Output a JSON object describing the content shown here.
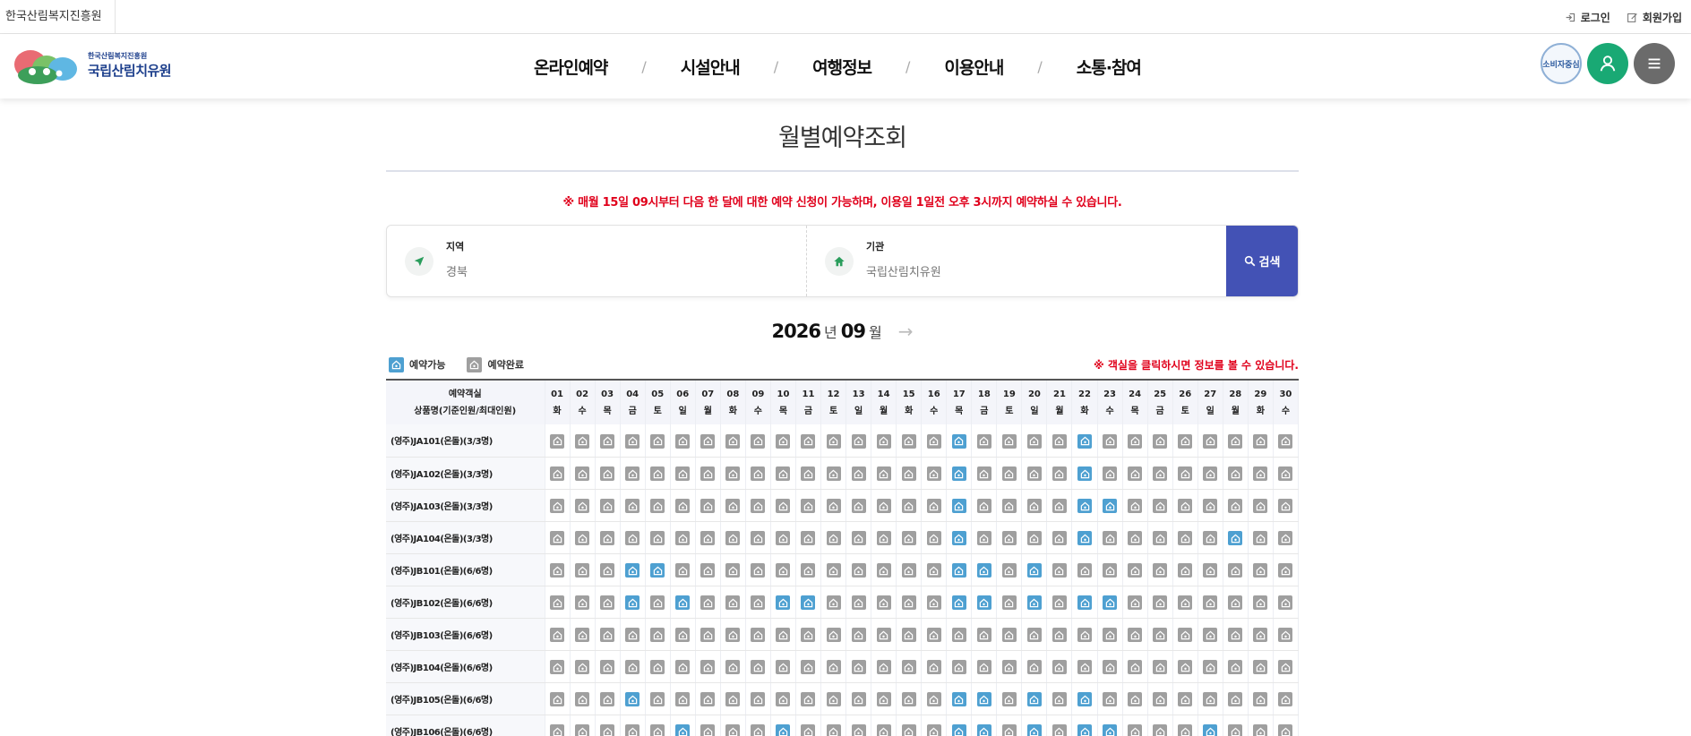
{
  "util": {
    "org_name": "한국산림복지진흥원",
    "login_label": "로그인",
    "join_label": "회원가입"
  },
  "header": {
    "logo_small": "한국산림복지진흥원",
    "logo_big": "국립산림치유원",
    "badge_text": "소비자중심",
    "nav": [
      "온라인예약",
      "시설안내",
      "여행정보",
      "이용안내",
      "소통·참여"
    ]
  },
  "page": {
    "title": "월별예약조회",
    "notice": "※ 매월 15일 09시부터 다음 한 달에 대한 예약 신청이 가능하며, 이용일 1일전 오후 3시까지 예약하실 수 있습니다."
  },
  "search": {
    "region_label": "지역",
    "region_value": "경북",
    "agency_label": "기관",
    "agency_value": "국립산림치유원",
    "button_label": "검색"
  },
  "month": {
    "year": "2026",
    "year_unit": "년",
    "month": "09",
    "month_unit": "월"
  },
  "legend": {
    "available": "예약가능",
    "completed": "예약완료",
    "note": "※ 객실을 클릭하시면 정보를 볼 수 있습니다."
  },
  "table": {
    "header_line1": "예약객실",
    "header_line2": "상품명(기준인원/최대인원)",
    "days": [
      {
        "num": "01",
        "dow": "화"
      },
      {
        "num": "02",
        "dow": "수"
      },
      {
        "num": "03",
        "dow": "목"
      },
      {
        "num": "04",
        "dow": "금"
      },
      {
        "num": "05",
        "dow": "토"
      },
      {
        "num": "06",
        "dow": "일"
      },
      {
        "num": "07",
        "dow": "월"
      },
      {
        "num": "08",
        "dow": "화"
      },
      {
        "num": "09",
        "dow": "수"
      },
      {
        "num": "10",
        "dow": "목"
      },
      {
        "num": "11",
        "dow": "금"
      },
      {
        "num": "12",
        "dow": "토"
      },
      {
        "num": "13",
        "dow": "일"
      },
      {
        "num": "14",
        "dow": "월"
      },
      {
        "num": "15",
        "dow": "화"
      },
      {
        "num": "16",
        "dow": "수"
      },
      {
        "num": "17",
        "dow": "목"
      },
      {
        "num": "18",
        "dow": "금"
      },
      {
        "num": "19",
        "dow": "토"
      },
      {
        "num": "20",
        "dow": "일"
      },
      {
        "num": "21",
        "dow": "월"
      },
      {
        "num": "22",
        "dow": "화"
      },
      {
        "num": "23",
        "dow": "수"
      },
      {
        "num": "24",
        "dow": "목"
      },
      {
        "num": "25",
        "dow": "금"
      },
      {
        "num": "26",
        "dow": "토"
      },
      {
        "num": "27",
        "dow": "일"
      },
      {
        "num": "28",
        "dow": "월"
      },
      {
        "num": "29",
        "dow": "화"
      },
      {
        "num": "30",
        "dow": "수"
      }
    ],
    "rows": [
      {
        "name": "(영주)JA101(온돌)(3/3명)",
        "available": [
          17,
          22
        ]
      },
      {
        "name": "(영주)JA102(온돌)(3/3명)",
        "available": [
          17,
          22
        ]
      },
      {
        "name": "(영주)JA103(온돌)(3/3명)",
        "available": [
          17,
          22,
          23
        ]
      },
      {
        "name": "(영주)JA104(온돌)(3/3명)",
        "available": [
          17,
          22,
          28
        ]
      },
      {
        "name": "(영주)JB101(온돌)(6/6명)",
        "available": [
          4,
          5,
          17,
          18,
          20
        ]
      },
      {
        "name": "(영주)JB102(온돌)(6/6명)",
        "available": [
          4,
          6,
          10,
          11,
          17,
          18,
          20,
          22,
          23
        ]
      },
      {
        "name": "(영주)JB103(온돌)(6/6명)",
        "available": []
      },
      {
        "name": "(영주)JB104(온돌)(6/6명)",
        "available": []
      },
      {
        "name": "(영주)JB105(온돌)(6/6명)",
        "available": [
          4,
          17,
          18,
          20,
          22
        ]
      },
      {
        "name": "(영주)JB106(온돌)(6/6명)",
        "available": [
          6,
          10,
          17,
          18,
          20,
          22,
          23,
          27
        ]
      }
    ]
  },
  "colors": {
    "available": "#4ea0d1",
    "completed": "#9f9f9f",
    "notice_red": "#e0001b",
    "search_btn": "#4352b5",
    "green_btn": "#19a974"
  }
}
